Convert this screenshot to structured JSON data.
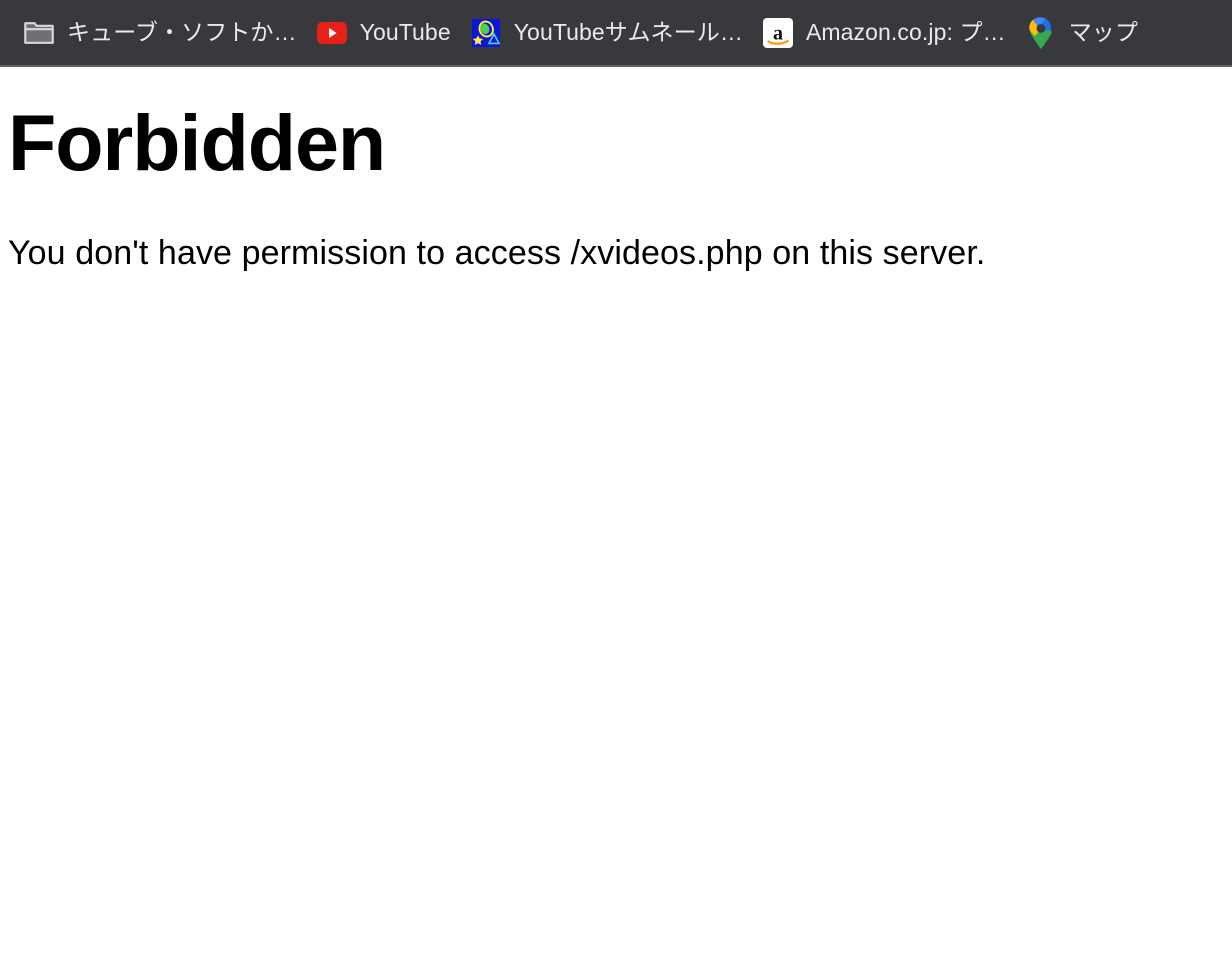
{
  "browser": {
    "bookmarks_bar": {
      "background_color": "#37393d",
      "text_color": "#e9eaec",
      "items": [
        {
          "icon": "folder-icon",
          "label": "キューブ・ソフトか…"
        },
        {
          "icon": "youtube-icon",
          "label": "YouTube"
        },
        {
          "icon": "paint-graphics-icon",
          "label": "YouTubeサムネール…"
        },
        {
          "icon": "amazon-icon",
          "label": "Amazon.co.jp: プ…"
        },
        {
          "icon": "google-maps-icon",
          "label": "マップ"
        }
      ]
    }
  },
  "page": {
    "background_color": "#ffffff",
    "text_color": "#000000",
    "heading": "Forbidden",
    "message": "You don't have permission to access /xvideos.php on this server."
  }
}
